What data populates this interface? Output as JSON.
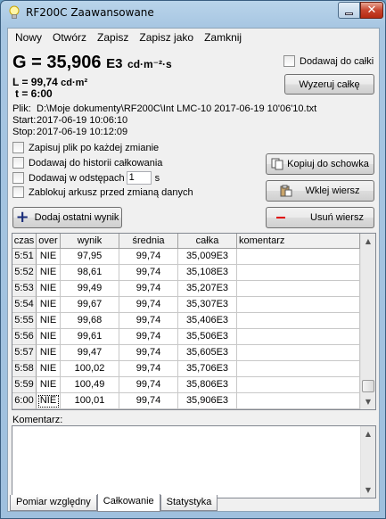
{
  "window": {
    "title": "RF200C Zaawansowane",
    "close_glyph": "✕"
  },
  "menu": [
    "Nowy",
    "Otwórz",
    "Zapisz",
    "Zapisz jako",
    "Zamknij"
  ],
  "readout": {
    "g_label": "G = 35,906",
    "g_unit_exp": "E3",
    "g_unit": "cd·m⁻²·s",
    "l_label": "L = 99,74",
    "l_unit": "cd·m²",
    "t_label": "t = 6:00"
  },
  "options": {
    "add_to_integral": "Dodawaj do całki",
    "reset_integral": "Wyzeruj całkę"
  },
  "file": {
    "file_label": "Plik:",
    "file_path": "D:\\Moje dokumenty\\RF200C\\Int LMC-10 2017-06-19 10'06'10.txt",
    "start_label": "Start:",
    "start_value": "2017-06-19 10:06:10",
    "stop_label": "Stop:",
    "stop_value": "2017-06-19 10:12:09"
  },
  "checkboxes": {
    "save_each_change": "Zapisuj plik po każdej zmianie",
    "add_to_history": "Dodawaj do historii całkowania",
    "add_interval": "Dodawaj w odstępach",
    "interval_value": "1",
    "interval_unit": "s",
    "lock_sheet": "Zablokuj arkusz przed zmianą danych"
  },
  "buttons": {
    "copy": "Kopiuj do schowka",
    "paste": "Wklej wiersz",
    "delete": "Usuń wiersz",
    "add_last": "Dodaj ostatni wynik"
  },
  "table": {
    "columns": [
      "czas",
      "over",
      "wynik",
      "średnia",
      "całka",
      "komentarz"
    ],
    "rows": [
      [
        "5:51",
        "NIE",
        "97,95",
        "99,74",
        "35,009E3",
        ""
      ],
      [
        "5:52",
        "NIE",
        "98,61",
        "99,74",
        "35,108E3",
        ""
      ],
      [
        "5:53",
        "NIE",
        "99,49",
        "99,74",
        "35,207E3",
        ""
      ],
      [
        "5:54",
        "NIE",
        "99,67",
        "99,74",
        "35,307E3",
        ""
      ],
      [
        "5:55",
        "NIE",
        "99,68",
        "99,74",
        "35,406E3",
        ""
      ],
      [
        "5:56",
        "NIE",
        "99,61",
        "99,74",
        "35,506E3",
        ""
      ],
      [
        "5:57",
        "NIE",
        "99,47",
        "99,74",
        "35,605E3",
        ""
      ],
      [
        "5:58",
        "NIE",
        "100,02",
        "99,74",
        "35,706E3",
        ""
      ],
      [
        "5:59",
        "NIE",
        "100,49",
        "99,74",
        "35,806E3",
        ""
      ],
      [
        "6:00",
        "NIE",
        "100,01",
        "99,74",
        "35,906E3",
        ""
      ]
    ]
  },
  "comment_label": "Komentarz:",
  "tabs": [
    "Pomiar względny",
    "Całkowanie",
    "Statystyka"
  ],
  "colors": {
    "delete_icon": "#e00000",
    "add_icon": "#1a2d7a"
  }
}
